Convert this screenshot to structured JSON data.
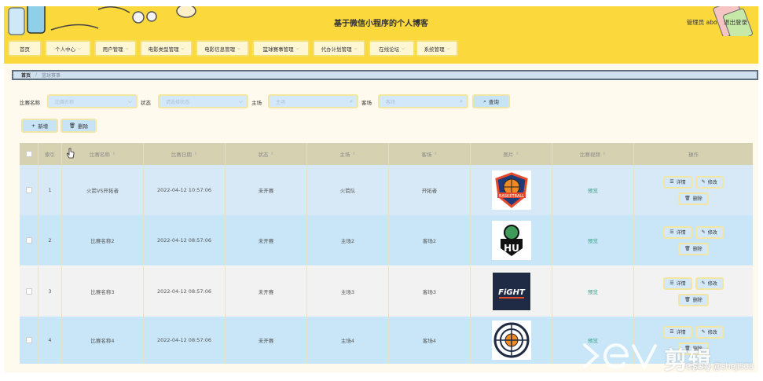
{
  "header": {
    "title": "基于微信小程序的个人博客",
    "user_label": "管理员 abo",
    "logout_label": "退出登录"
  },
  "nav": [
    {
      "label": "首页",
      "dropdown": false
    },
    {
      "label": "个人中心",
      "dropdown": true
    },
    {
      "label": "用户管理",
      "dropdown": true
    },
    {
      "label": "电影类型管理",
      "dropdown": true
    },
    {
      "label": "电影信息管理",
      "dropdown": true
    },
    {
      "label": "篮球赛事管理",
      "dropdown": true
    },
    {
      "label": "代办计划管理",
      "dropdown": true
    },
    {
      "label": "在线论坛",
      "dropdown": true
    },
    {
      "label": "系统管理",
      "dropdown": true
    }
  ],
  "breadcrumb": {
    "home": "首页",
    "separator": "/",
    "current": "篮球赛事"
  },
  "filters": {
    "name_label": "比赛名称",
    "name_placeholder": "比赛名称",
    "status_label": "状态",
    "status_placeholder": "请选择状态",
    "home_label": "主场",
    "home_placeholder": "主场",
    "away_label": "客场",
    "away_placeholder": "客场",
    "search_label": "查询"
  },
  "actions": {
    "add_label": "新增",
    "delete_label": "删除"
  },
  "table": {
    "headers": [
      "索引",
      "比赛名称",
      "比赛日期",
      "状态",
      "主场",
      "客场",
      "图片",
      "比赛视频",
      "操作"
    ],
    "preview_label": "预览",
    "detail_label": "详情",
    "edit_label": "修改",
    "delete_label": "删除",
    "rows": [
      {
        "index": "1",
        "name": "火箭VS开拓者",
        "date": "2022-04-12 10:57:06",
        "status": "未开赛",
        "home": "火箭队",
        "away": "开拓者",
        "image": "basketball-badge-logo"
      },
      {
        "index": "2",
        "name": "比赛名称2",
        "date": "2022-04-12 08:57:06",
        "status": "未开赛",
        "home": "主场2",
        "away": "客场2",
        "image": "green-team-logo"
      },
      {
        "index": "3",
        "name": "比赛名称3",
        "date": "2022-04-12 08:57:06",
        "status": "未开赛",
        "home": "主场3",
        "away": "客场3",
        "image": "navy-team-logo"
      },
      {
        "index": "4",
        "name": "比赛名称4",
        "date": "2022-04-12 08:57:06",
        "status": "未开赛",
        "home": "主场4",
        "away": "客场4",
        "image": "target-team-logo"
      }
    ]
  },
  "watermark": {
    "text": "剪辑",
    "logo": "ev-logo"
  },
  "csdn": "CSDN @sheji508",
  "colors": {
    "header_bg": "#fbd83c",
    "page_bg": "#fffaed",
    "table_head_bg": "#d6d1b0",
    "row_blue": "#c8e6f8",
    "row_grey": "#f2f2f2",
    "input_bg": "#d3e8f8",
    "input_border": "#f2e6a2"
  }
}
